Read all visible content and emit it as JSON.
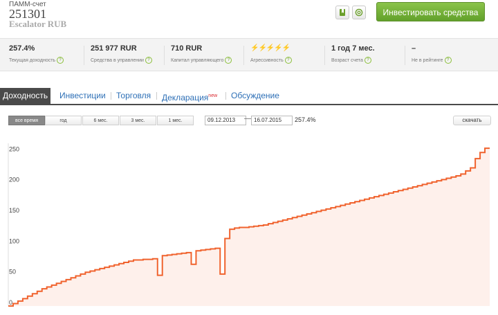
{
  "account": {
    "type": "ПАММ-счет",
    "number": "251301",
    "name": "Escalator RUB"
  },
  "header": {
    "invest_label": "Инвестировать средства",
    "bookmark_icon": "bookmark-icon",
    "email_icon": "at-sign-icon"
  },
  "stats": [
    {
      "value": "257.4%",
      "label": "Текущая доходность"
    },
    {
      "value": "251 977 RUR",
      "label": "Средства в управлении"
    },
    {
      "value": "710 RUR",
      "label": "Капитал управляющего"
    },
    {
      "value": "⚡⚡⚡⚡⚡",
      "label": "Агрессивность"
    },
    {
      "value": "1 год 7 мес.",
      "label": "Возраст счета"
    },
    {
      "value": "–",
      "label": "Не в рейтинге"
    }
  ],
  "tabs": [
    {
      "label": "Доходность",
      "active": true
    },
    {
      "label": "Инвестиции"
    },
    {
      "label": "Торговля"
    },
    {
      "label": "Декларация",
      "badge": "new"
    },
    {
      "label": "Обсуждение"
    }
  ],
  "period_buttons": [
    "все время",
    "год",
    "6 мес.",
    "3 мес.",
    "1 мес."
  ],
  "date_range": {
    "from": "09.12.2013",
    "dash": "—",
    "to": "16.07.2015",
    "yield": "257.4%"
  },
  "download_label": "скачать",
  "colors": {
    "accent_green": "#7ab33e",
    "line": "#f0622d",
    "tab_active": "#4a4a4a",
    "link": "#2d6fb6",
    "bolt": "#f0522d"
  },
  "chart_data": {
    "type": "area",
    "x": [
      0,
      1,
      2,
      3,
      4,
      5,
      6,
      7,
      8,
      9,
      10,
      11,
      12,
      13,
      14,
      15,
      16,
      17,
      18,
      19,
      20,
      21,
      22,
      23,
      24,
      25,
      26,
      27,
      28,
      29,
      30,
      31,
      32,
      33,
      34,
      35,
      36,
      37,
      38,
      39,
      40,
      41,
      42,
      43,
      44,
      45,
      46,
      47,
      48,
      49,
      50,
      51,
      52,
      53,
      54,
      55,
      56,
      57,
      58,
      59,
      60,
      61,
      62,
      63,
      64,
      65,
      66,
      67,
      68,
      69,
      70,
      71,
      72,
      73,
      74,
      75,
      76,
      77,
      78,
      79,
      80,
      81,
      82,
      83,
      84,
      85,
      86,
      87,
      88,
      89,
      90,
      91,
      92,
      93,
      94,
      95,
      96,
      97,
      98,
      99,
      100
    ],
    "values": [
      0,
      4,
      8,
      12,
      16,
      20,
      24,
      28,
      31,
      34,
      37,
      40,
      43,
      46,
      49,
      52,
      55,
      57,
      59,
      61,
      63,
      65,
      67,
      69,
      71,
      73,
      75,
      75,
      76,
      76,
      77,
      50,
      82,
      83,
      84,
      85,
      86,
      87,
      68,
      90,
      91,
      92,
      93,
      94,
      52,
      110,
      125,
      127,
      128,
      128,
      129,
      130,
      131,
      132,
      134,
      136,
      138,
      140,
      142,
      144,
      146,
      148,
      150,
      152,
      154,
      156,
      158,
      160,
      162,
      164,
      166,
      168,
      170,
      172,
      174,
      176,
      178,
      180,
      182,
      184,
      186,
      188,
      190,
      192,
      194,
      196,
      198,
      200,
      202,
      204,
      206,
      208,
      210,
      212,
      215,
      220,
      225,
      240,
      250,
      257,
      257
    ],
    "yticks": [
      0,
      50,
      100,
      150,
      200,
      250
    ],
    "ylim": [
      0,
      265
    ],
    "grid": false
  }
}
